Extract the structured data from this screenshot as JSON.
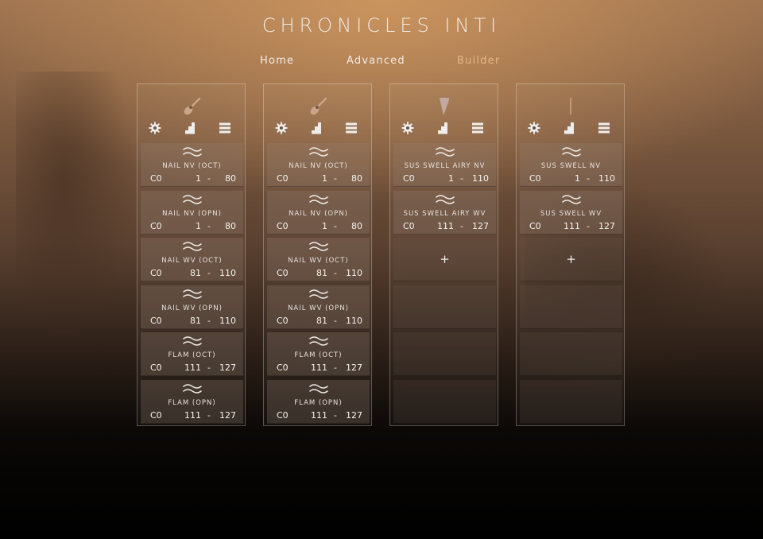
{
  "app": {
    "title": "CHRONICLES INTI"
  },
  "nav": {
    "tabs": [
      "Home",
      "Advanced",
      "Builder"
    ],
    "active": "Builder"
  },
  "icons": {
    "guitar": "guitar-icon",
    "harp": "harp-icon",
    "stick": "line-icon",
    "gear": "gear-icon",
    "stairs": "stairs-icon",
    "menu": "menu-icon",
    "wave": "wave-icon",
    "plus": "plus-icon"
  },
  "columns": [
    {
      "icon": "guitar-icon",
      "slots": [
        {
          "name": "NAIL NV (OCT)",
          "key": "C0",
          "lo": "1",
          "dash": "-",
          "hi": "80"
        },
        {
          "name": "NAIL NV (OPN)",
          "key": "C0",
          "lo": "1",
          "dash": "-",
          "hi": "80"
        },
        {
          "name": "NAIL WV (OCT)",
          "key": "C0",
          "lo": "81",
          "dash": "-",
          "hi": "110"
        },
        {
          "name": "NAIL WV (OPN)",
          "key": "C0",
          "lo": "81",
          "dash": "-",
          "hi": "110"
        },
        {
          "name": "FLAM (OCT)",
          "key": "C0",
          "lo": "111",
          "dash": "-",
          "hi": "127"
        },
        {
          "name": "FLAM (OPN)",
          "key": "C0",
          "lo": "111",
          "dash": "-",
          "hi": "127"
        }
      ]
    },
    {
      "icon": "guitar-icon",
      "slots": [
        {
          "name": "NAIL NV (OCT)",
          "key": "C0",
          "lo": "1",
          "dash": "-",
          "hi": "80"
        },
        {
          "name": "NAIL NV (OPN)",
          "key": "C0",
          "lo": "1",
          "dash": "-",
          "hi": "80"
        },
        {
          "name": "NAIL WV (OCT)",
          "key": "C0",
          "lo": "81",
          "dash": "-",
          "hi": "110"
        },
        {
          "name": "NAIL WV (OPN)",
          "key": "C0",
          "lo": "81",
          "dash": "-",
          "hi": "110"
        },
        {
          "name": "FLAM (OCT)",
          "key": "C0",
          "lo": "111",
          "dash": "-",
          "hi": "127"
        },
        {
          "name": "FLAM (OPN)",
          "key": "C0",
          "lo": "111",
          "dash": "-",
          "hi": "127"
        }
      ]
    },
    {
      "icon": "harp-icon",
      "slots": [
        {
          "name": "SUS SWELL AIRY NV",
          "key": "C0",
          "lo": "1",
          "dash": "-",
          "hi": "110"
        },
        {
          "name": "SUS SWELL AIRY WV",
          "key": "C0",
          "lo": "111",
          "dash": "-",
          "hi": "127"
        }
      ],
      "add_label": "+"
    },
    {
      "icon": "line-icon",
      "slots": [
        {
          "name": "SUS SWELL NV",
          "key": "C0",
          "lo": "1",
          "dash": "-",
          "hi": "110"
        },
        {
          "name": "SUS SWELL WV",
          "key": "C0",
          "lo": "111",
          "dash": "-",
          "hi": "127"
        }
      ],
      "add_label": "+"
    }
  ]
}
